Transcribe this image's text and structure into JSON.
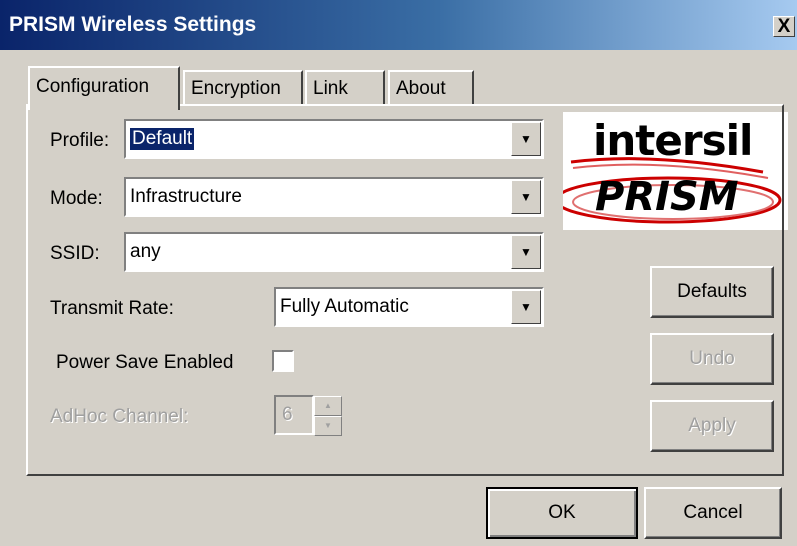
{
  "window": {
    "title": "PRISM Wireless Settings",
    "close_label": "X"
  },
  "tabs": [
    {
      "label": "Configuration",
      "active": true
    },
    {
      "label": "Encryption",
      "active": false
    },
    {
      "label": "Link",
      "active": false
    },
    {
      "label": "About",
      "active": false
    }
  ],
  "config": {
    "profile_label": "Profile:",
    "profile_value": "Default",
    "mode_label": "Mode:",
    "mode_value": "Infrastructure",
    "ssid_label": "SSID:",
    "ssid_value": "any",
    "transmit_rate_label": "Transmit Rate:",
    "transmit_rate_value": "Fully Automatic",
    "power_save_label": "Power Save Enabled",
    "power_save_checked": false,
    "adhoc_channel_label": "AdHoc Channel:",
    "adhoc_channel_value": "6"
  },
  "logo": {
    "line1": "intersil",
    "line2": "PRISM",
    "accent_color": "#cc0000"
  },
  "side_buttons": {
    "defaults": "Defaults",
    "undo": "Undo",
    "apply": "Apply"
  },
  "footer_buttons": {
    "ok": "OK",
    "cancel": "Cancel"
  },
  "icons": {
    "dropdown": "chevron-down-icon",
    "spin_up": "spin-up-icon",
    "spin_down": "spin-down-icon"
  }
}
